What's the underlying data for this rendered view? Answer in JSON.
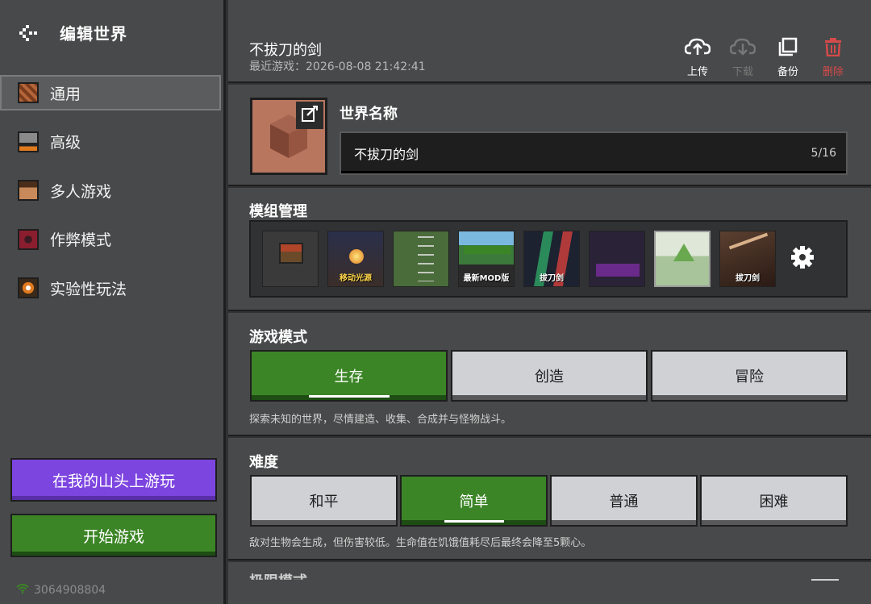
{
  "sidebar": {
    "title": "编辑世界",
    "items": [
      {
        "label": "通用",
        "icon": "command-block-icon",
        "color": "#a0522d",
        "active": true
      },
      {
        "label": "高级",
        "icon": "furnace-icon",
        "color": "#707070",
        "active": false
      },
      {
        "label": "多人游戏",
        "icon": "player-head-icon",
        "color": "#c88a5a",
        "active": false
      },
      {
        "label": "作弊模式",
        "icon": "cheat-block-icon",
        "color": "#8b1e2e",
        "active": false
      },
      {
        "label": "实验性玩法",
        "icon": "experimental-icon",
        "color": "#e07a1f",
        "active": false
      }
    ],
    "play_on_realm_label": "在我的山头上游玩",
    "start_game_label": "开始游戏",
    "connection_id": "3064908804"
  },
  "header": {
    "world_title": "不拔刀的剑",
    "last_played": "最近游戏：2026-08-08 21:42:41",
    "actions": {
      "upload": "上传",
      "download": "下载",
      "backup": "备份",
      "delete": "删除"
    }
  },
  "world_name": {
    "section_title": "世界名称",
    "value": "不拔刀的剑",
    "char_count": "5/16"
  },
  "mods": {
    "section_title": "模组管理",
    "items": [
      {
        "caption": "",
        "bg": "#3a3a3a",
        "icon": "mod-craft-table-icon"
      },
      {
        "caption": "移动光源",
        "bg": "#2a2f4a",
        "icon": "mod-moving-light-icon"
      },
      {
        "caption": "",
        "bg": "#4a6b3a",
        "icon": "mod-stats-icon"
      },
      {
        "caption": "最新MOD版",
        "bg": "#3b7a3a",
        "icon": "mod-chain-gather-icon"
      },
      {
        "caption": "拔刀剑",
        "bg": "#1c2230",
        "icon": "mod-slash-blade-icon"
      },
      {
        "caption": "",
        "bg": "#2a2236",
        "icon": "mod-dark-icon"
      },
      {
        "caption": "",
        "bg": "#a8c49a",
        "icon": "mod-better-grass-icon"
      },
      {
        "caption": "拔刀剑",
        "bg": "#3a2a22",
        "icon": "mod-slash-blade-2-icon"
      }
    ]
  },
  "game_mode": {
    "section_title": "游戏模式",
    "options": [
      "生存",
      "创造",
      "冒险"
    ],
    "selected": "生存",
    "description": "探索未知的世界，尽情建造、收集、合成并与怪物战斗。"
  },
  "difficulty": {
    "section_title": "难度",
    "options": [
      "和平",
      "简单",
      "普通",
      "困难"
    ],
    "selected": "简单",
    "description": "敌对生物会生成，但伤害较低。生命值在饥饿值耗尽后最终会降至5颗心。"
  },
  "next_section": {
    "title": "极限模式"
  },
  "colors": {
    "green": "#3c8527",
    "purple": "#7d45e0",
    "danger": "#d54a4a",
    "panel": "#48494a",
    "background": "#313233"
  }
}
